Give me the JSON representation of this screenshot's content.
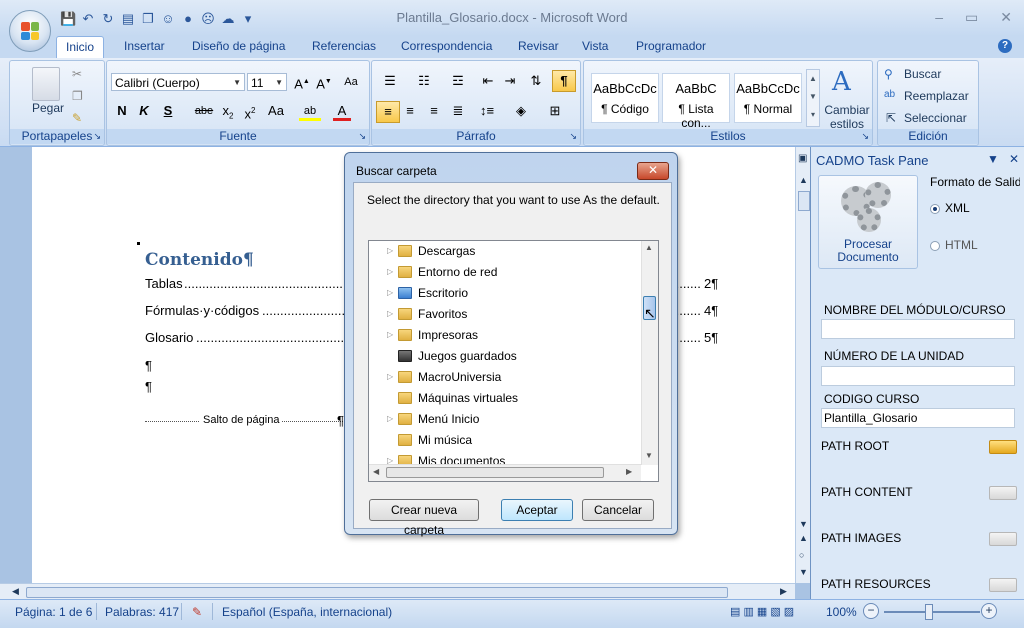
{
  "window": {
    "title": "Plantilla_Glosario.docx - Microsoft Word"
  },
  "ribbon_tabs": [
    "Inicio",
    "Insertar",
    "Diseño de página",
    "Referencias",
    "Correspondencia",
    "Revisar",
    "Vista",
    "Programador"
  ],
  "ribbon": {
    "clipboard": {
      "label": "Portapapeles",
      "paste": "Pegar"
    },
    "font": {
      "label": "Fuente",
      "name": "Calibri (Cuerpo)",
      "size": "11"
    },
    "paragraph": {
      "label": "Párrafo"
    },
    "styles": {
      "label": "Estilos",
      "items": [
        {
          "sample": "AaBbCcDc",
          "name": "¶ Código"
        },
        {
          "sample": "AaBbC",
          "name": "¶ Lista con..."
        },
        {
          "sample": "AaBbCcDc",
          "name": "¶ Normal"
        }
      ],
      "change": "Cambiar estilos"
    },
    "editing": {
      "label": "Edición",
      "find": "Buscar",
      "replace": "Reemplazar",
      "select": "Seleccionar"
    }
  },
  "document": {
    "heading": "Contenido¶",
    "toc": [
      {
        "left": "Tablas",
        "right": "2¶"
      },
      {
        "left": "Fórmulas·y·códigos",
        "right": "4¶"
      },
      {
        "left": "Glosario",
        "right": "5¶"
      }
    ],
    "pilcrow": "¶",
    "page_break": "Salto de página"
  },
  "dialog": {
    "title": "Buscar carpeta",
    "message": "Select the directory that you want to use As the default.",
    "folders": [
      {
        "name": "Descargas",
        "expandable": true
      },
      {
        "name": "Entorno de red",
        "expandable": true
      },
      {
        "name": "Escritorio",
        "expandable": true
      },
      {
        "name": "Favoritos",
        "expandable": true
      },
      {
        "name": "Impresoras",
        "expandable": true
      },
      {
        "name": "Juegos guardados",
        "expandable": false
      },
      {
        "name": "MacroUniversia",
        "expandable": true
      },
      {
        "name": "Máquinas virtuales",
        "expandable": false
      },
      {
        "name": "Menú Inicio",
        "expandable": true
      },
      {
        "name": "Mi música",
        "expandable": false
      },
      {
        "name": "Mis documentos",
        "expandable": true
      }
    ],
    "new_folder": "Crear nueva carpeta",
    "ok": "Aceptar",
    "cancel": "Cancelar"
  },
  "task_pane": {
    "title": "CADMO Task Pane",
    "process_button": "Procesar Documento",
    "output_format_label": "Formato de Salida",
    "formats": [
      "XML",
      "HTML"
    ],
    "selected_format": "XML",
    "fields": [
      {
        "label": "NOMBRE DEL MÓDULO/CURSO",
        "value": ""
      },
      {
        "label": "NÚMERO DE LA UNIDAD",
        "value": ""
      },
      {
        "label": "CODIGO CURSO",
        "value": "Plantilla_Glosario"
      }
    ],
    "paths": [
      "PATH ROOT",
      "PATH CONTENT",
      "PATH IMAGES",
      "PATH RESOURCES"
    ]
  },
  "status_bar": {
    "page": "Página: 1 de 6",
    "words": "Palabras: 417",
    "language": "Español (España, internacional)",
    "zoom": "100%"
  }
}
